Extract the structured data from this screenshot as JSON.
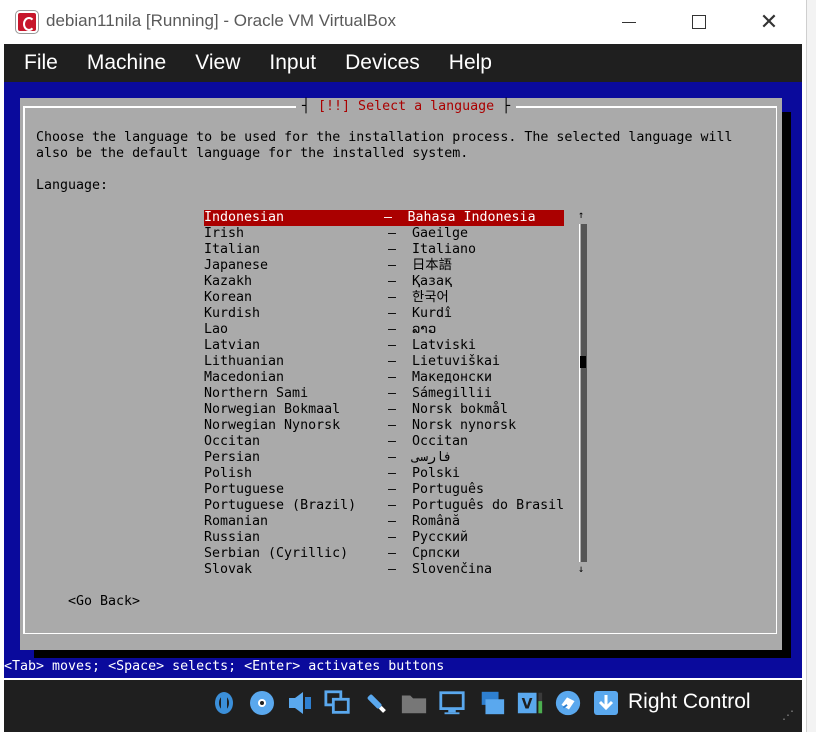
{
  "window": {
    "title": "debian11nila [Running] - Oracle VM VirtualBox"
  },
  "menu": {
    "items": [
      "File",
      "Machine",
      "View",
      "Input",
      "Devices",
      "Help"
    ]
  },
  "installer": {
    "title": "[!!] Select a language",
    "description": "Choose the language to be used for the installation process. The selected language will\nalso be the default language for the installed system.",
    "language_label": "Language:",
    "languages": [
      {
        "name": "Indonesian",
        "native": "Bahasa Indonesia",
        "selected": true
      },
      {
        "name": "Irish",
        "native": "Gaeilge"
      },
      {
        "name": "Italian",
        "native": "Italiano"
      },
      {
        "name": "Japanese",
        "native": "日本語"
      },
      {
        "name": "Kazakh",
        "native": "Қазақ"
      },
      {
        "name": "Korean",
        "native": "한국어"
      },
      {
        "name": "Kurdish",
        "native": "Kurdî"
      },
      {
        "name": "Lao",
        "native": "ລາວ"
      },
      {
        "name": "Latvian",
        "native": "Latviski"
      },
      {
        "name": "Lithuanian",
        "native": "Lietuviškai"
      },
      {
        "name": "Macedonian",
        "native": "Македонски"
      },
      {
        "name": "Northern Sami",
        "native": "Sámegillii"
      },
      {
        "name": "Norwegian Bokmaal",
        "native": "Norsk bokmål"
      },
      {
        "name": "Norwegian Nynorsk",
        "native": "Norsk nynorsk"
      },
      {
        "name": "Occitan",
        "native": "Occitan"
      },
      {
        "name": "Persian",
        "native": "فارسی"
      },
      {
        "name": "Polish",
        "native": "Polski"
      },
      {
        "name": "Portuguese",
        "native": "Português"
      },
      {
        "name": "Portuguese (Brazil)",
        "native": "Português do Brasil"
      },
      {
        "name": "Romanian",
        "native": "Română"
      },
      {
        "name": "Russian",
        "native": "Русский"
      },
      {
        "name": "Serbian (Cyrillic)",
        "native": "Српски"
      },
      {
        "name": "Slovak",
        "native": "Slovenčina"
      }
    ],
    "dash": "–",
    "go_back": "<Go Back>",
    "status_line": "<Tab> moves; <Space> selects; <Enter> activates buttons"
  },
  "statusbar": {
    "icons": [
      "hard-disk-icon",
      "optical-drive-icon",
      "audio-icon",
      "network-icon",
      "usb-icon",
      "shared-folders-icon",
      "display-icon",
      "video-capture-icon",
      "virtualization-icon",
      "mouse-integration-icon",
      "keyboard-capture-icon"
    ],
    "host_key": "Right Control"
  },
  "colors": {
    "vm_background": "#0a0a9c",
    "dialog_background": "#aaaaaa",
    "selection": "#aa0000",
    "title_text": "#aa0000"
  }
}
